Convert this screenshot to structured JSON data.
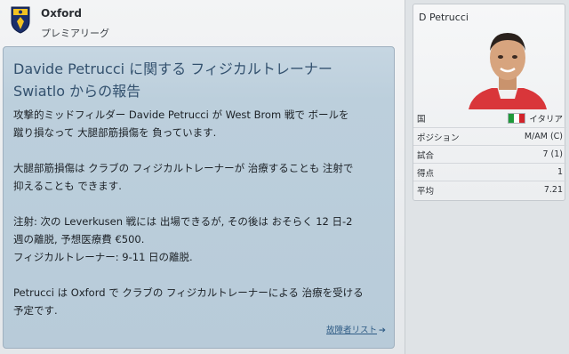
{
  "club": {
    "name": "Oxford",
    "league": "プレミアリーグ"
  },
  "news": {
    "title_line1": "Davide Petrucci に関する フィジカルトレーナー",
    "title_line2": "Swiatlo からの報告",
    "paragraphs": [
      [
        "攻撃的ミッドフィルダー Davide Petrucci が West Brom 戦で ボールを",
        "蹴り損なって 大腿部筋損傷を 負っています."
      ],
      [
        "大腿部筋損傷は クラブの フィジカルトレーナーが 治療することも 注射で",
        "抑えることも できます."
      ],
      [
        "注射: 次の Leverkusen 戦には 出場できるが, その後は おそらく 12 日-2",
        "週の離脱, 予想医療費 €500.",
        "フィジカルトレーナー: 9-11 日の離脱."
      ],
      [
        "Petrucci は Oxford で クラブの フィジカルトレーナーによる 治療を受ける",
        "予定です."
      ]
    ],
    "injury_link": "故障者リスト"
  },
  "player": {
    "name": "D Petrucci",
    "stats": [
      {
        "label": "国",
        "value": "イタリア",
        "flag": true
      },
      {
        "label": "ポジション",
        "value": "M/AM (C)"
      },
      {
        "label": "試合",
        "value": "7 (1)"
      },
      {
        "label": "得点",
        "value": "1"
      },
      {
        "label": "平均",
        "value": "7.21"
      }
    ]
  },
  "colors": {
    "card_bg": "#bccfdc",
    "title": "#33516e",
    "link": "#2f5c85",
    "flag": [
      "#1f9a3a",
      "#ffffff",
      "#d2232a"
    ]
  },
  "icons": [
    "club-crest-icon",
    "player-photo",
    "italy-flag-icon",
    "arrow-right-icon"
  ]
}
